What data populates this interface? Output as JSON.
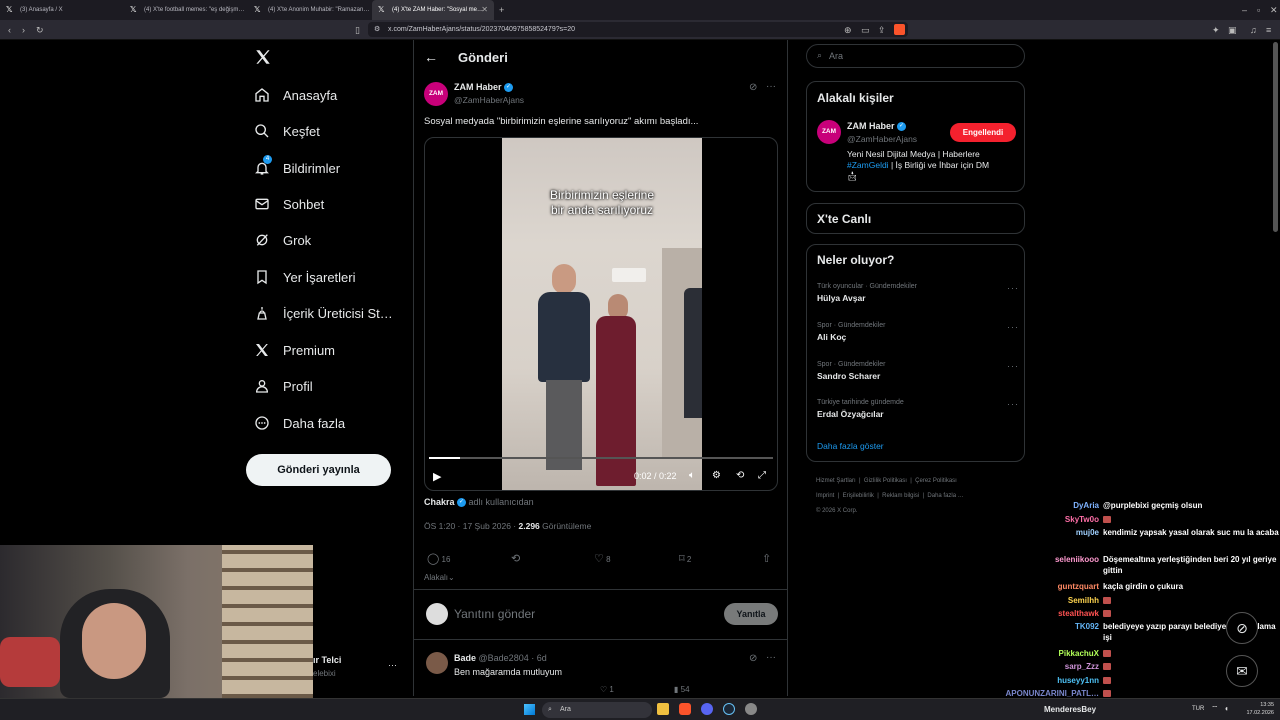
{
  "browser": {
    "tabs": [
      {
        "label": "(3) Anasayfa / X"
      },
      {
        "label": "(4) X'te football memes: \"eş değişm…"
      },
      {
        "label": "(4) X'te Anonim Muhabir: \"Ramazan…"
      },
      {
        "label": "(4) X'te ZAM Haber: \"Sosyal me…"
      }
    ],
    "new_tab": "+",
    "url": "x.com/ZamHaberAjans/status/2023704097585852479?s=20"
  },
  "sidebar": {
    "logo": "x-logo",
    "items": [
      {
        "label": "Anasayfa",
        "icon": "home-icon"
      },
      {
        "label": "Keşfet",
        "icon": "search-icon"
      },
      {
        "label": "Bildirimler",
        "icon": "bell-icon",
        "badge": "4"
      },
      {
        "label": "Sohbet",
        "icon": "mail-icon"
      },
      {
        "label": "Grok",
        "icon": "grok-icon"
      },
      {
        "label": "Yer İşaretleri",
        "icon": "bookmark-icon"
      },
      {
        "label": "İçerik Üreticisi St…",
        "icon": "creator-icon"
      },
      {
        "label": "Premium",
        "icon": "x-icon"
      },
      {
        "label": "Profil",
        "icon": "user-icon"
      },
      {
        "label": "Daha fazla",
        "icon": "more-icon"
      }
    ],
    "post_button": "Gönderi yayınla",
    "account_name": "ır Telci",
    "account_handle": "elebixi"
  },
  "main": {
    "header_title": "Gönderi",
    "tweet": {
      "author_name": "ZAM Haber",
      "author_handle": "@ZamHaberAjans",
      "avatar_text": "ZAM",
      "text": "Sosyal medyada \"birbirimizin eşlerine sarılıyoruz\" akımı başladı...",
      "video_caption_line1": "Birbirimizin eşlerine",
      "video_caption_line2": "bir anda sarılıyoruz",
      "video_time": "0:02 / 0:22",
      "video_progress": 0.09,
      "tag_user": "Chakra",
      "tag_suffix": "adlı kullanıcıdan",
      "timestamp": "ÖS 1:20 · 17 Şub 2026 · ",
      "views_count": "2.296",
      "views_label": " Görüntüleme",
      "replies": "16",
      "retweets": "",
      "likes": "8",
      "bookmarks": "2",
      "related_label": "Alakalı"
    },
    "reply_placeholder": "Yanıtını gönder",
    "reply_button": "Yanıtla",
    "reply": {
      "author_name": "Bade",
      "author_handle": "@Bade2804",
      "age": "· 6d",
      "text": "Ben mağaramda mutluyum",
      "replies": "",
      "retweets": "",
      "likes": "1",
      "views": "54"
    }
  },
  "right": {
    "search_placeholder": "Ara",
    "related_title": "Alakalı kişiler",
    "related_name": "ZAM Haber",
    "related_handle": "@ZamHaberAjans",
    "related_button": "Engellendi",
    "related_bio_1": "Yeni Nesil Dijital Medya | Haberlere",
    "related_bio_hashtag": "#ZamGeldi",
    "related_bio_2": " | İş Birliği ve İhbar için DM",
    "live_title": "X'te Canlı",
    "trends_title": "Neler oluyor?",
    "trends": [
      {
        "category": "Türk oyuncular · Gündemdekiler",
        "name": "Hülya Avşar"
      },
      {
        "category": "Spor · Gündemdekiler",
        "name": "Ali Koç"
      },
      {
        "category": "Spor · Gündemdekiler",
        "name": "Sandro Scharer"
      },
      {
        "category": "Türkiye tarihinde gündemde",
        "name": "Erdal Özyağcılar"
      }
    ],
    "show_more": "Daha fazla göster",
    "footer": [
      "Hizmet Şartları",
      "Gizlilik Politikası",
      "Çerez Politikası",
      "Imprint",
      "Erişilebilirlik",
      "Reklam bilgisi",
      "Daha fazla …",
      "© 2026 X Corp."
    ]
  },
  "chat": [
    {
      "name": "DyAria",
      "msg": "@purplebixi geçmiş olsun",
      "color": "#7fb3ff"
    },
    {
      "name": "SkyTw0o",
      "msg": "",
      "color": "#ff6fa8"
    },
    {
      "name": "muj0e",
      "msg": "kendimiz yapsak yasal olarak suc mu la acaba",
      "color": "#9fd0ff"
    },
    {
      "name": "seleniikooo",
      "msg": "Döşemealtına yerleştiğinden beri 20 yıl geriye gittin",
      "color": "#ff9ad0"
    },
    {
      "name": "guntzquart",
      "msg": "kaçla girdin o çukura",
      "color": "#ff8a65"
    },
    {
      "name": "Semilhh",
      "msg": "",
      "color": "#ffd54f"
    },
    {
      "name": "stealthawk",
      "msg": "",
      "color": "#ff5252"
    },
    {
      "name": "TK092",
      "msg": "belediyeye yazıp parayı belediye ye kakalama işi",
      "color": "#64b5f6"
    },
    {
      "name": "PikkachuX",
      "msg": "",
      "color": "#b2ff59"
    },
    {
      "name": "sarp_Zzz",
      "msg": "",
      "color": "#ce93d8"
    },
    {
      "name": "huseyy1nn",
      "msg": "",
      "color": "#4fc3f7"
    },
    {
      "name": "APONUNZARINI_PATL…",
      "msg": "",
      "color": "#7986cb"
    }
  ],
  "taskbar": {
    "search": "Ara",
    "streamer": "MenderesBey",
    "lang": "TUR",
    "time": "13:35",
    "date": "17.02.2026"
  },
  "colors": {
    "accent": "#1d9bf0",
    "blocked": "#f4212e",
    "background": "#000000",
    "border": "#2f3336"
  }
}
